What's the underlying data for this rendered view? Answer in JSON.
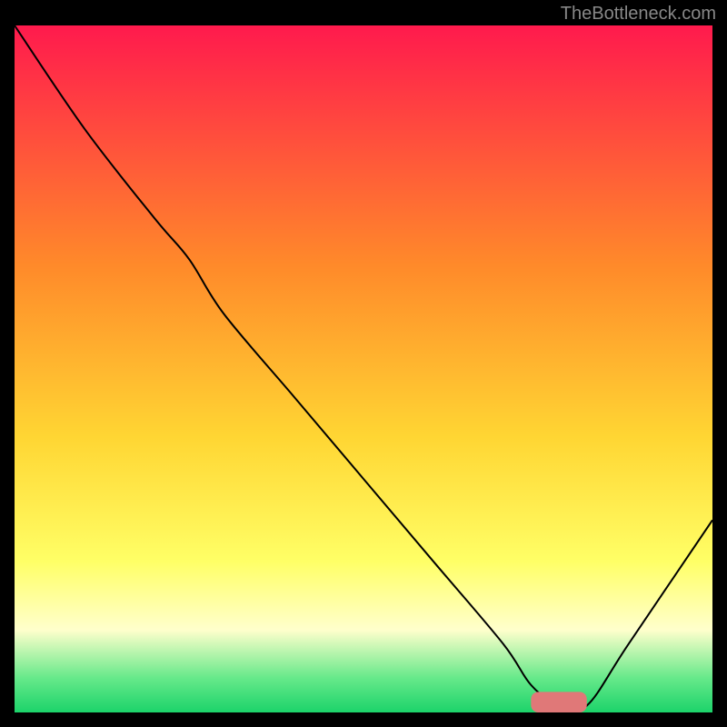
{
  "watermark": "TheBottleneck.com",
  "chart_data": {
    "type": "line",
    "title": "",
    "xlabel": "",
    "ylabel": "",
    "xlim": [
      0,
      100
    ],
    "ylim": [
      0,
      100
    ],
    "grid": false,
    "background": {
      "type": "vertical-gradient",
      "stops": [
        {
          "pos": 0,
          "color": "#ff1a4d"
        },
        {
          "pos": 35,
          "color": "#ff8a2a"
        },
        {
          "pos": 60,
          "color": "#ffd633"
        },
        {
          "pos": 78,
          "color": "#ffff66"
        },
        {
          "pos": 88,
          "color": "#ffffcc"
        },
        {
          "pos": 95,
          "color": "#66e98a"
        },
        {
          "pos": 100,
          "color": "#1cd36a"
        }
      ]
    },
    "series": [
      {
        "name": "bottleneck-curve",
        "color": "#000000",
        "stroke_width": 2,
        "x": [
          0,
          10,
          20,
          25,
          30,
          40,
          50,
          60,
          70,
          74,
          78,
          82,
          88,
          100
        ],
        "y": [
          100,
          85,
          72,
          66,
          58,
          46,
          34,
          22,
          10,
          4,
          1,
          1,
          10,
          28
        ]
      }
    ],
    "marker": {
      "name": "optimal-range",
      "shape": "rounded-bar",
      "color": "#e07878",
      "x_start": 74,
      "x_end": 82,
      "y": 1.5,
      "height": 3
    }
  }
}
